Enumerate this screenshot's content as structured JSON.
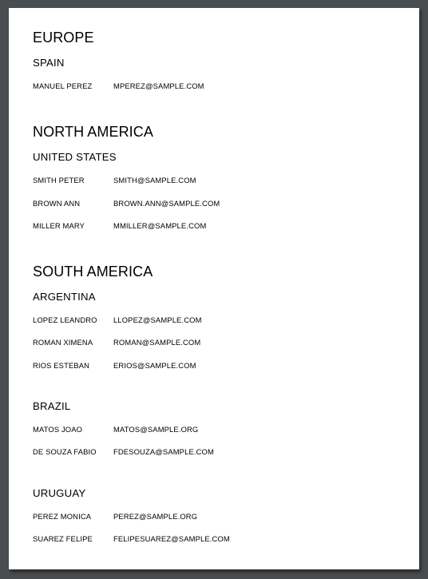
{
  "regions": [
    {
      "name": "EUROPE",
      "countries": [
        {
          "name": "SPAIN",
          "people": [
            {
              "name": "MANUEL PEREZ",
              "email": "MPEREZ@SAMPLE.COM"
            }
          ]
        }
      ]
    },
    {
      "name": "NORTH AMERICA",
      "countries": [
        {
          "name": "UNITED STATES",
          "people": [
            {
              "name": "SMITH PETER",
              "email": "SMITH@SAMPLE.COM"
            },
            {
              "name": "BROWN ANN",
              "email": "BROWN.ANN@SAMPLE.COM"
            },
            {
              "name": "MILLER MARY",
              "email": "MMILLER@SAMPLE.COM"
            }
          ]
        }
      ]
    },
    {
      "name": "SOUTH AMERICA",
      "countries": [
        {
          "name": "ARGENTINA",
          "people": [
            {
              "name": "LOPEZ LEANDRO",
              "email": "LLOPEZ@SAMPLE.COM"
            },
            {
              "name": "ROMAN XIMENA",
              "email": "ROMAN@SAMPLE.COM"
            },
            {
              "name": "RIOS ESTEBAN",
              "email": "ERIOS@SAMPLE.COM"
            }
          ]
        },
        {
          "name": "BRAZIL",
          "people": [
            {
              "name": "MATOS JOAO",
              "email": "MATOS@SAMPLE.ORG"
            },
            {
              "name": "DE SOUZA FABIO",
              "email": "FDESOUZA@SAMPLE.COM"
            }
          ]
        },
        {
          "name": "URUGUAY",
          "people": [
            {
              "name": "PEREZ MONICA",
              "email": "PEREZ@SAMPLE.ORG"
            },
            {
              "name": "SUAREZ FELIPE",
              "email": "FELIPESUAREZ@SAMPLE.COM"
            }
          ]
        }
      ]
    }
  ]
}
